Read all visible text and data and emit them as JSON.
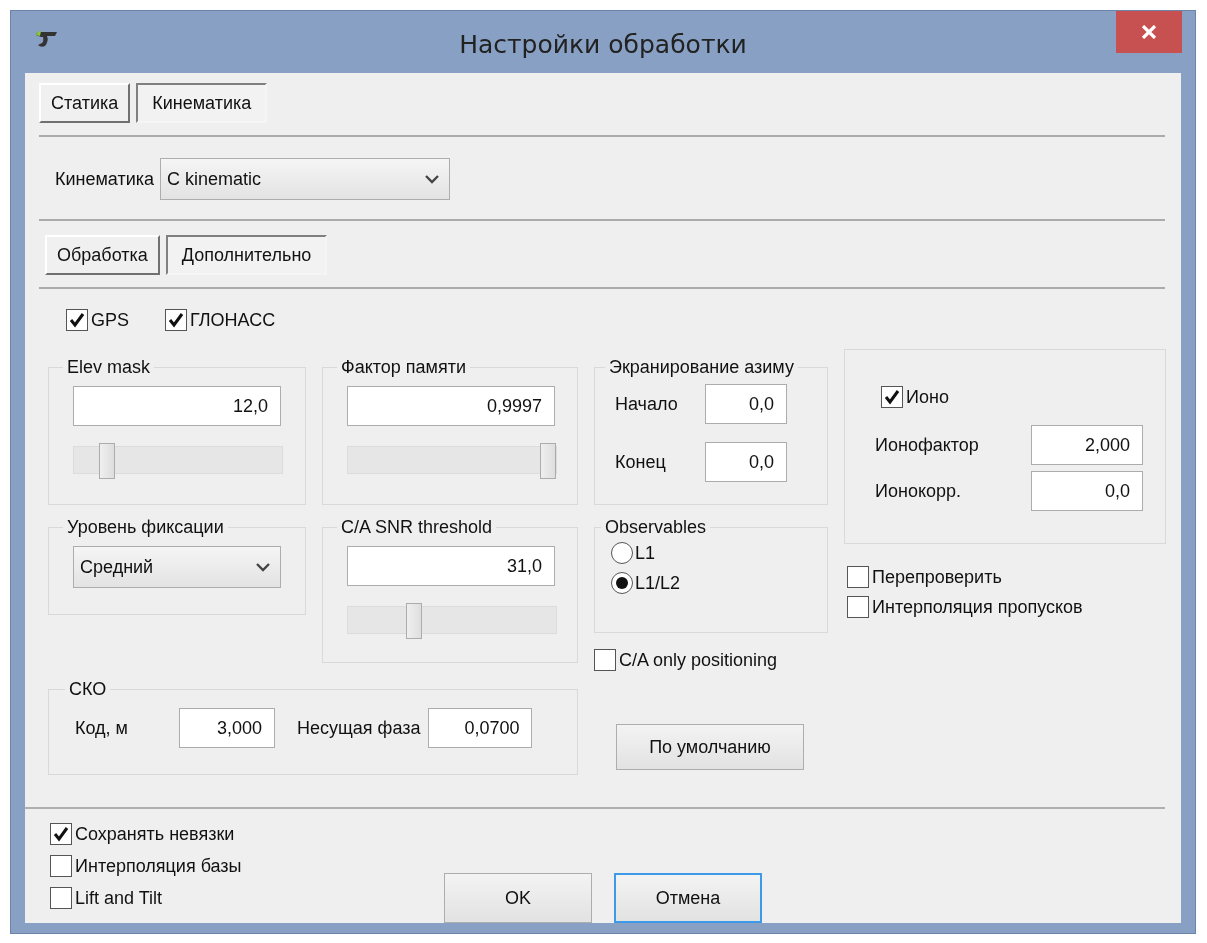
{
  "window": {
    "title": "Настройки обработки"
  },
  "tabs": [
    {
      "label": "Статика",
      "selected": false
    },
    {
      "label": "Кинематика",
      "selected": true
    }
  ],
  "kinematics": {
    "label": "Кинематика",
    "value": "C kinematic"
  },
  "subtabs": [
    {
      "label": "Обработка",
      "selected": false
    },
    {
      "label": "Дополнительно",
      "selected": true
    }
  ],
  "systems": [
    {
      "label": "GPS",
      "checked": true
    },
    {
      "label": "ГЛОНАСС",
      "checked": true
    }
  ],
  "elev_mask": {
    "title": "Elev mask",
    "value": "12,0",
    "level": 0.13
  },
  "memory_factor": {
    "title": "Фактор памяти",
    "value": "0,9997",
    "level": 1.0
  },
  "azimuth_mask": {
    "title": "Экранирование азиму",
    "fields": [
      {
        "label": "Начало",
        "value": "0,0"
      },
      {
        "label": "Конец",
        "value": "0,0"
      }
    ]
  },
  "iono": {
    "label": "Ионо",
    "checked": true,
    "fields": [
      {
        "label": "Ионофактор",
        "value": "2,000"
      },
      {
        "label": "Ионокорр.",
        "value": "0,0"
      }
    ]
  },
  "fix_level": {
    "title": "Уровень фиксации",
    "value": "Средний"
  },
  "snr_threshold": {
    "title": "C/A SNR threshold",
    "value": "31,0",
    "level": 0.3
  },
  "observables": {
    "title": "Observables",
    "options": [
      {
        "label": "L1",
        "selected": false
      },
      {
        "label": "L1/L2",
        "selected": true
      }
    ]
  },
  "extra_checks": [
    {
      "label": "Перепроверить",
      "checked": false
    },
    {
      "label": "Интерполяция пропусков",
      "checked": false
    }
  ],
  "ca_only": {
    "label": "C/A only positioning",
    "checked": false
  },
  "sko": {
    "title": "СКО",
    "fields": [
      {
        "label": "Код, м",
        "value": "3,000"
      },
      {
        "label": "Несущая фаза",
        "value": "0,0700"
      }
    ]
  },
  "default_button": "По умолчанию",
  "bottom_checks": [
    {
      "label": "Сохранять невязки",
      "checked": true
    },
    {
      "label": "Интерполяция базы",
      "checked": false
    },
    {
      "label": "Lift and Tilt",
      "checked": false
    }
  ],
  "buttons": [
    {
      "label": "OK",
      "focused": false
    },
    {
      "label": "Отмена",
      "focused": true
    }
  ]
}
